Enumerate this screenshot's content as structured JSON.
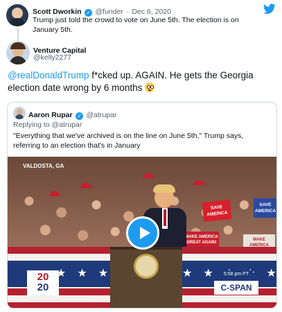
{
  "tweet1": {
    "name": "Scott Dworkin",
    "handle": "@funder",
    "sep": "·",
    "date": "Dec 6, 2020",
    "text": "Trump just told the crowd to vote on June 5th. The election is on January 5th."
  },
  "tweet2": {
    "name": "Venture Capital",
    "handle": "@kelly2277",
    "mention": "@realDonaldTrump",
    "text": " f*cked up. AGAIN. He gets the Georgia election date wrong by 6 months",
    "emoji": "flushed-face"
  },
  "quote": {
    "name": "Aaron Rupar",
    "handle": "@atrupar",
    "replying_prefix": "Replying to ",
    "replying_handle": "@atrupar",
    "text": "\"Everything that we've archived is on the line on June 5th,\" Trump says, referring to an election that's in January"
  },
  "video": {
    "location": "VALDOSTA, GA",
    "sign1": "SAVE AMERICA",
    "sign2": "SAVE AMERICA",
    "sign3": "MAKE AMERICA GREAT AGAIN!",
    "sign4": "MAKE AMERICA GREAT AGAIN!",
    "logo_top": "20",
    "logo_bottom": "20",
    "time": "5:58 pm PT",
    "network": "C-SPAN"
  },
  "colors": {
    "twitter_blue": "#1d9bf0",
    "text": "#0f1419",
    "muted": "#536471"
  },
  "icons": [
    "twitter-bird-icon",
    "verified-badge-icon",
    "play-icon",
    "flushed-face-emoji"
  ]
}
